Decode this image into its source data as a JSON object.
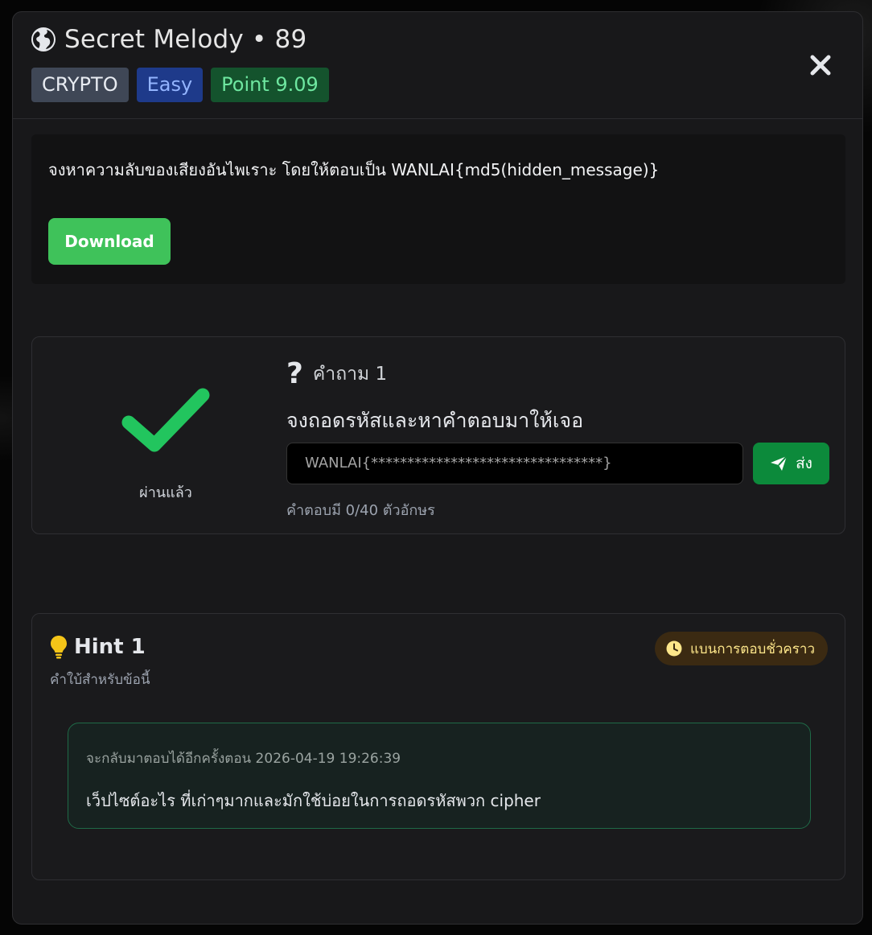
{
  "challenge": {
    "title": "Secret Melody • 89",
    "category": "CRYPTO",
    "difficulty": "Easy",
    "points": "Point 9.09",
    "description": "จงหาความลับของเสียงอันไพเราะ โดยให้ตอบเป็น WANLAI{md5(hidden_message)}",
    "download_label": "Download"
  },
  "question": {
    "status": "ผ่านแล้ว",
    "label": "คำถาม 1",
    "text": "จงถอดรหัสและหาคำตอบมาให้เจอ",
    "answer_value": "WANLAI{********************************}",
    "send_label": "ส่ง",
    "char_count": "คำตอบมี  0/40  ตัวอักษร"
  },
  "hint": {
    "title": "Hint 1",
    "subtitle": "คำใบ้สำหรับข้อนี้",
    "mode_badge": "แบนการตอบชั่วคราว",
    "retry_text": "จะกลับมาตอบได้อีกครั้งตอน 2026-04-19 19:26:39",
    "text": "เว็ปไซต์อะไร ที่เก่าๆมากและมักใช้บ่อยในการถอดรหัสพวก cipher"
  },
  "colors": {
    "success": "#22c55e",
    "download": "#3fc25a",
    "send": "#0c8a3b",
    "hint_border": "#1f6a47",
    "warning": "#f5c518"
  },
  "icons": [
    "globe-icon",
    "close-icon",
    "check-icon",
    "question-icon",
    "send-icon",
    "lightbulb-icon",
    "clock-icon"
  ]
}
